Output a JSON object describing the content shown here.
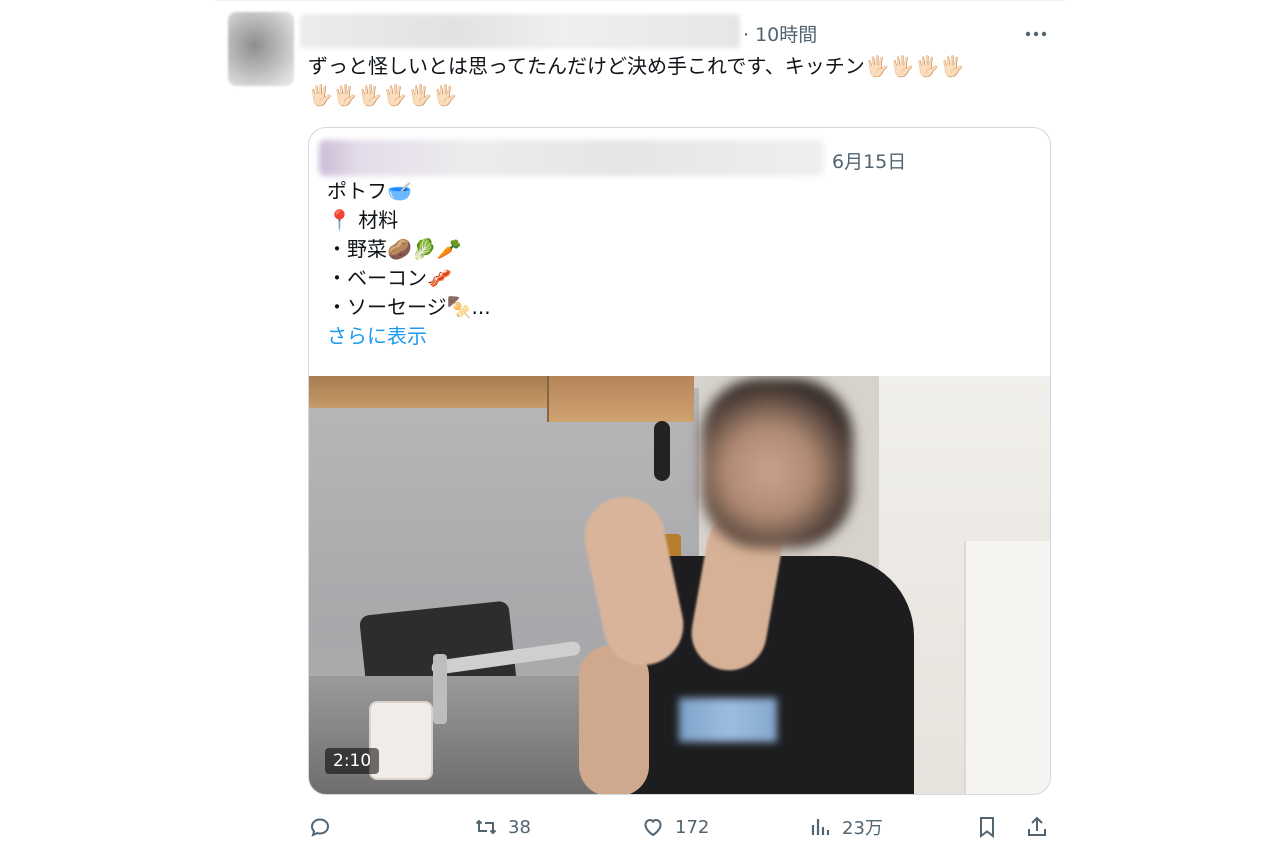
{
  "post": {
    "time": "· 10時間",
    "text": "ずっと怪しいとは思ってたんだけど決め手これです、キッチン",
    "hand_emoji": "🖐🏻",
    "hand_count_line1": 4,
    "hand_count_line2": 6
  },
  "quoted": {
    "date": "6月15日",
    "lines": [
      "ポトフ🥣",
      "📍 材料",
      "・野菜🥔🥬🥕",
      "・ベーコン🥓",
      "・ソーセージ🍢..."
    ],
    "show_more": "さらに表示",
    "video_duration": "2:10"
  },
  "actions": {
    "reply_count": "",
    "retweet_count": "38",
    "like_count": "172",
    "views_count": "23万"
  },
  "colors": {
    "text": "#0f1419",
    "secondary": "#536471",
    "link": "#1d9bf0",
    "border": "#cfd9de"
  }
}
